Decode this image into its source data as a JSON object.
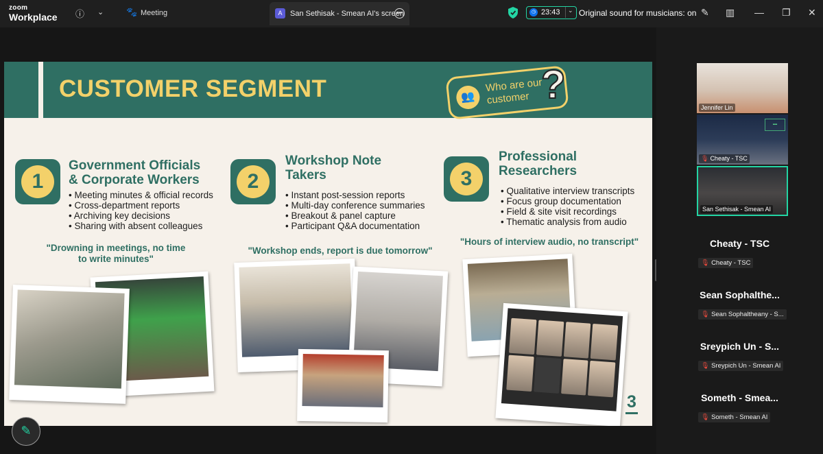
{
  "topbar": {
    "brand_line1": "zoom",
    "brand_line2": "Workplace",
    "meeting_label": "Meeting",
    "share_title": "San Sethisak - Smean AI's screen",
    "timer": "23:43",
    "original_sound": "Original sound for musicians: on"
  },
  "slide": {
    "title": "CUSTOMER SEGMENT",
    "badge_text": "Who are our customer",
    "page_number": "3",
    "segments": [
      {
        "number": "1",
        "title_line1": "Government Officials",
        "title_line2": "& Corporate Workers",
        "items": [
          "Meeting minutes & official records",
          "Cross-department reports",
          "Archiving key decisions",
          "Sharing with absent colleagues"
        ],
        "quote_line1": "\"Drowning in meetings, no time",
        "quote_line2": "to write minutes\""
      },
      {
        "number": "2",
        "title_line1": "Workshop Note",
        "title_line2": "Takers",
        "items": [
          "Instant post-session reports",
          "Multi-day conference summaries",
          "Breakout & panel capture",
          "Participant Q&A documentation"
        ],
        "quote_line1": "\"Workshop ends, report is due tomorrow\"",
        "quote_line2": ""
      },
      {
        "number": "3",
        "title_line1": "Professional",
        "title_line2": "Researchers",
        "items": [
          "Qualitative interview transcripts",
          "Focus group documentation",
          "Field & site visit recordings",
          "Thematic analysis from audio"
        ],
        "quote_line1": "\"Hours of interview audio, no transcript\"",
        "quote_line2": ""
      }
    ]
  },
  "panel": {
    "tiles": [
      {
        "name": "Jennifer Lin"
      },
      {
        "name": "Cheaty - TSC"
      },
      {
        "name": "San Sethisak - Smean AI"
      }
    ],
    "participants": [
      {
        "display": "Cheaty - TSC",
        "label": "Cheaty - TSC"
      },
      {
        "display": "Sean Sophalthe...",
        "label": "Sean Sophaltheany - S..."
      },
      {
        "display": "Sreypich Un - S...",
        "label": "Sreypich Un - Smean AI"
      },
      {
        "display": "Someth - Smea...",
        "label": "Someth - Smean AI"
      }
    ]
  },
  "colors": {
    "accent_green": "#23d5a4",
    "slide_teal": "#2f6f63",
    "slide_yellow": "#f3d16a"
  }
}
